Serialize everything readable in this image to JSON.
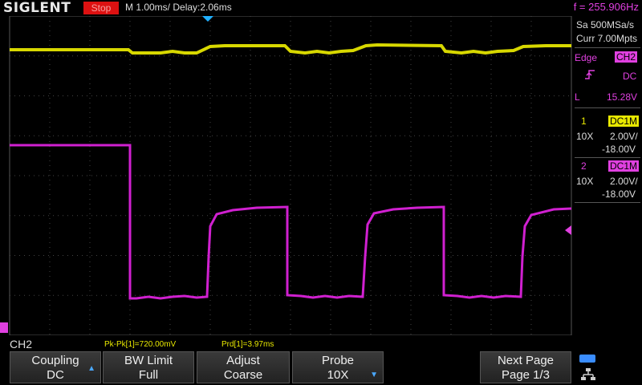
{
  "header": {
    "logo": "SIGLENT",
    "status": "Stop",
    "timebase": "M 1.00ms/ Delay:2.06ms",
    "frequency": "f = 255.906Hz"
  },
  "acquisition": {
    "sample_rate": "Sa 500MSa/s",
    "memory": "Curr 7.00Mpts"
  },
  "trigger": {
    "type_label": "Edge",
    "source": "CH2",
    "coupling": "DC",
    "level_label": "L",
    "level": "15.28V"
  },
  "channels": [
    {
      "number": "1",
      "coupling": "DC1M",
      "probe": "10X",
      "scale": "2.00V/",
      "offset": "-18.00V",
      "color": "#e8e800"
    },
    {
      "number": "2",
      "coupling": "DC1M",
      "probe": "10X",
      "scale": "2.00V/",
      "offset": "-18.00V",
      "color": "#e040e0"
    }
  ],
  "footer": {
    "active_channel": "CH2",
    "measurement_1": "Pk-Pk[1]=720.00mV",
    "measurement_2": "Prd[1]=3.97ms"
  },
  "softkeys": [
    {
      "title": "Coupling",
      "value": "DC"
    },
    {
      "title": "BW Limit",
      "value": "Full"
    },
    {
      "title": "Adjust",
      "value": "Coarse"
    },
    {
      "title": "Probe",
      "value": "10X"
    },
    {
      "title": "Next Page",
      "value": "Page 1/3"
    }
  ],
  "icons": {
    "usb": "usb-icon",
    "network": "network-icon"
  }
}
